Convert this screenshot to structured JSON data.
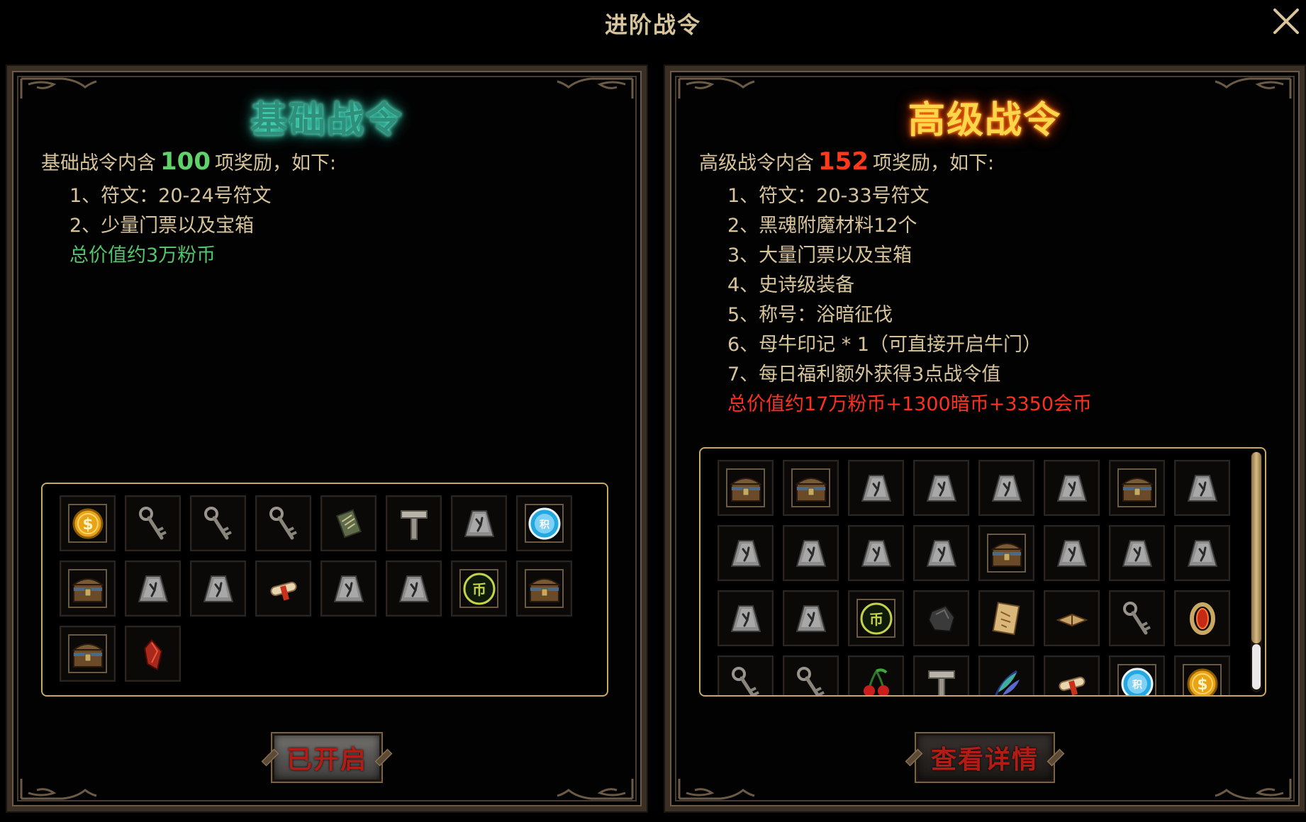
{
  "window": {
    "title": "进阶战令",
    "close_label": "关闭"
  },
  "basic": {
    "heading": "基础战令",
    "intro_prefix": "基础战令内含",
    "count": "100",
    "intro_suffix": "项奖励，如下:",
    "rewards": [
      "1、符文：20-24号符文",
      "2、少量门票以及宝箱"
    ],
    "total": "总价值约3万粉币",
    "button_label": "已开启",
    "items": [
      "gold-coin-icon",
      "key-icon",
      "key-icon",
      "key-icon",
      "scroll-tome-icon",
      "hammer-icon",
      "rune-stone-icon",
      "blue-token-icon",
      "treasure-chest-icon",
      "rune-stone-icon",
      "rune-stone-icon",
      "paper-scroll-icon",
      "rune-stone-icon",
      "rune-stone-icon",
      "currency-coin-icon",
      "treasure-chest-icon",
      "treasure-chest-icon",
      "red-gem-icon"
    ]
  },
  "advanced": {
    "heading": "高级战令",
    "intro_prefix": "高级战令内含",
    "count": "152",
    "intro_suffix": "项奖励，如下:",
    "rewards": [
      "1、符文：20-33号符文",
      "2、黑魂附魔材料12个",
      "3、大量门票以及宝箱",
      "4、史诗级装备",
      "5、称号：浴暗征伐",
      "6、母牛印记 * 1（可直接开启牛门）",
      "7、每日福利额外获得3点战令值"
    ],
    "total": "总价值约17万粉币+1300暗币+3350会币",
    "button_label": "查看详情",
    "items": [
      "treasure-chest-icon",
      "treasure-chest-icon",
      "rune-stone-icon",
      "rune-stone-icon",
      "rune-stone-icon",
      "rune-stone-icon",
      "treasure-chest-icon",
      "rune-stone-icon",
      "rune-stone-icon",
      "rune-stone-icon",
      "rune-stone-icon",
      "rune-stone-icon",
      "treasure-chest-icon",
      "rune-stone-icon",
      "rune-stone-icon",
      "rune-stone-icon",
      "rune-stone-icon",
      "rune-stone-icon",
      "currency-coin-icon",
      "dark-stone-icon",
      "treasure-map-icon",
      "open-book-icon",
      "key-icon",
      "ring-icon",
      "key-icon",
      "key-icon",
      "cherry-icon",
      "hammer-icon",
      "feather-icon",
      "paper-scroll-icon",
      "blue-token-icon",
      "gold-coin-icon"
    ]
  },
  "colors": {
    "gold_text": "#d8c49a",
    "basic_accent": "#5fd36a",
    "advanced_accent": "#ff3a1a",
    "frame": "#c9a863",
    "button_text": "#b31c14"
  }
}
